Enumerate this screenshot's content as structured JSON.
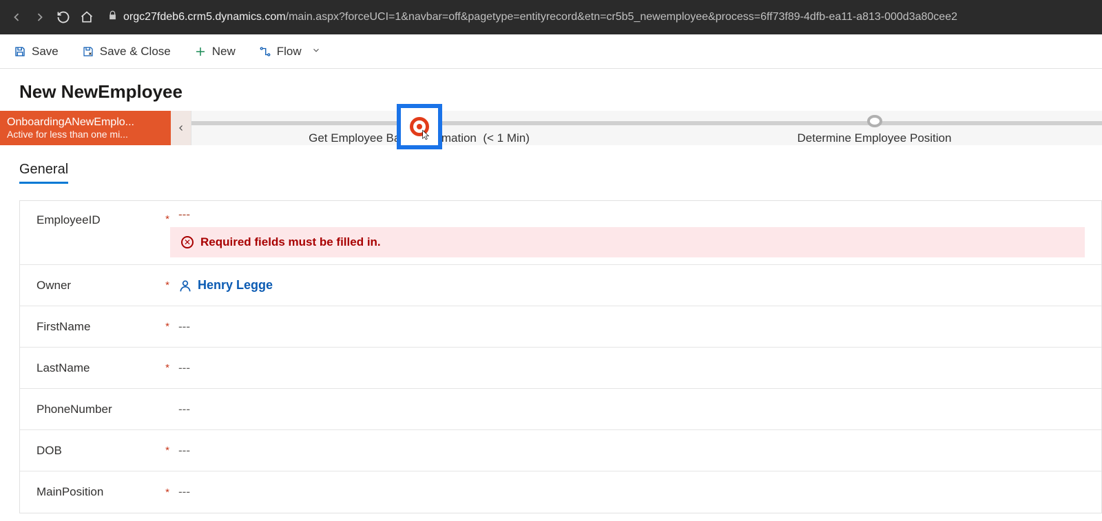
{
  "browser": {
    "url_domain": "orgc27fdeb6.crm5.dynamics.com",
    "url_path": "/main.aspx?forceUCI=1&navbar=off&pagetype=entityrecord&etn=cr5b5_newemployee&process=6ff73f89-4dfb-ea11-a813-000d3a80cee2"
  },
  "commands": {
    "save": "Save",
    "save_close": "Save & Close",
    "new": "New",
    "flow": "Flow"
  },
  "page": {
    "title": "New NewEmployee",
    "process_name": "OnboardingANewEmplo...",
    "process_status": "Active for less than one mi...",
    "stage1_label": "Get Employee Basic Information",
    "stage1_time": "(< 1 Min)",
    "stage2_label": "Determine Employee Position",
    "tab_general": "General"
  },
  "form": {
    "employee_id_label": "EmployeeID",
    "employee_id_value": "---",
    "error_msg": "Required fields must be filled in.",
    "owner_label": "Owner",
    "owner_value": "Henry Legge",
    "first_name_label": "FirstName",
    "first_name_value": "---",
    "last_name_label": "LastName",
    "last_name_value": "---",
    "phone_label": "PhoneNumber",
    "phone_value": "---",
    "dob_label": "DOB",
    "dob_value": "---",
    "main_position_label": "MainPosition",
    "main_position_value": "---"
  }
}
